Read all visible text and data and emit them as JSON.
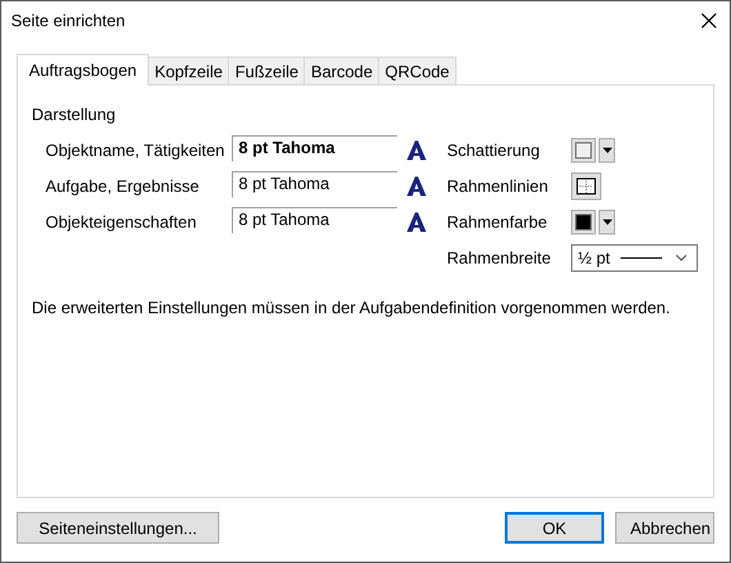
{
  "window": {
    "title": "Seite einrichten"
  },
  "tabs": [
    {
      "label": "Auftragsbogen",
      "selected": true
    },
    {
      "label": "Kopfzeile",
      "selected": false
    },
    {
      "label": "Fußzeile",
      "selected": false
    },
    {
      "label": "Barcode",
      "selected": false
    },
    {
      "label": "QRCode",
      "selected": false
    }
  ],
  "group": {
    "title": "Darstellung"
  },
  "fonts": [
    {
      "label": "Objektname, Tätigkeiten",
      "value": "8 pt Tahoma",
      "bold": true
    },
    {
      "label": "Aufgabe, Ergebnisse",
      "value": "8 pt Tahoma",
      "bold": false
    },
    {
      "label": "Objekteigenschaften",
      "value": "8 pt Tahoma",
      "bold": false
    }
  ],
  "frame": [
    {
      "kind": "color",
      "label": "Schattierung",
      "color": "#f0f0f0"
    },
    {
      "kind": "lines",
      "label": "Rahmenlinien"
    },
    {
      "kind": "color",
      "label": "Rahmenfarbe",
      "color": "#000000"
    },
    {
      "kind": "width",
      "label": "Rahmenbreite",
      "value": "½ pt"
    }
  ],
  "note": "Die erweiterten Einstellungen müssen in der Aufgabendefinition vorgenommen werden.",
  "buttons": [
    {
      "label": "Seiteneinstellungen...",
      "kind": "left"
    },
    {
      "label": "OK",
      "kind": "default"
    },
    {
      "label": "Abbrechen",
      "kind": "normal"
    }
  ]
}
